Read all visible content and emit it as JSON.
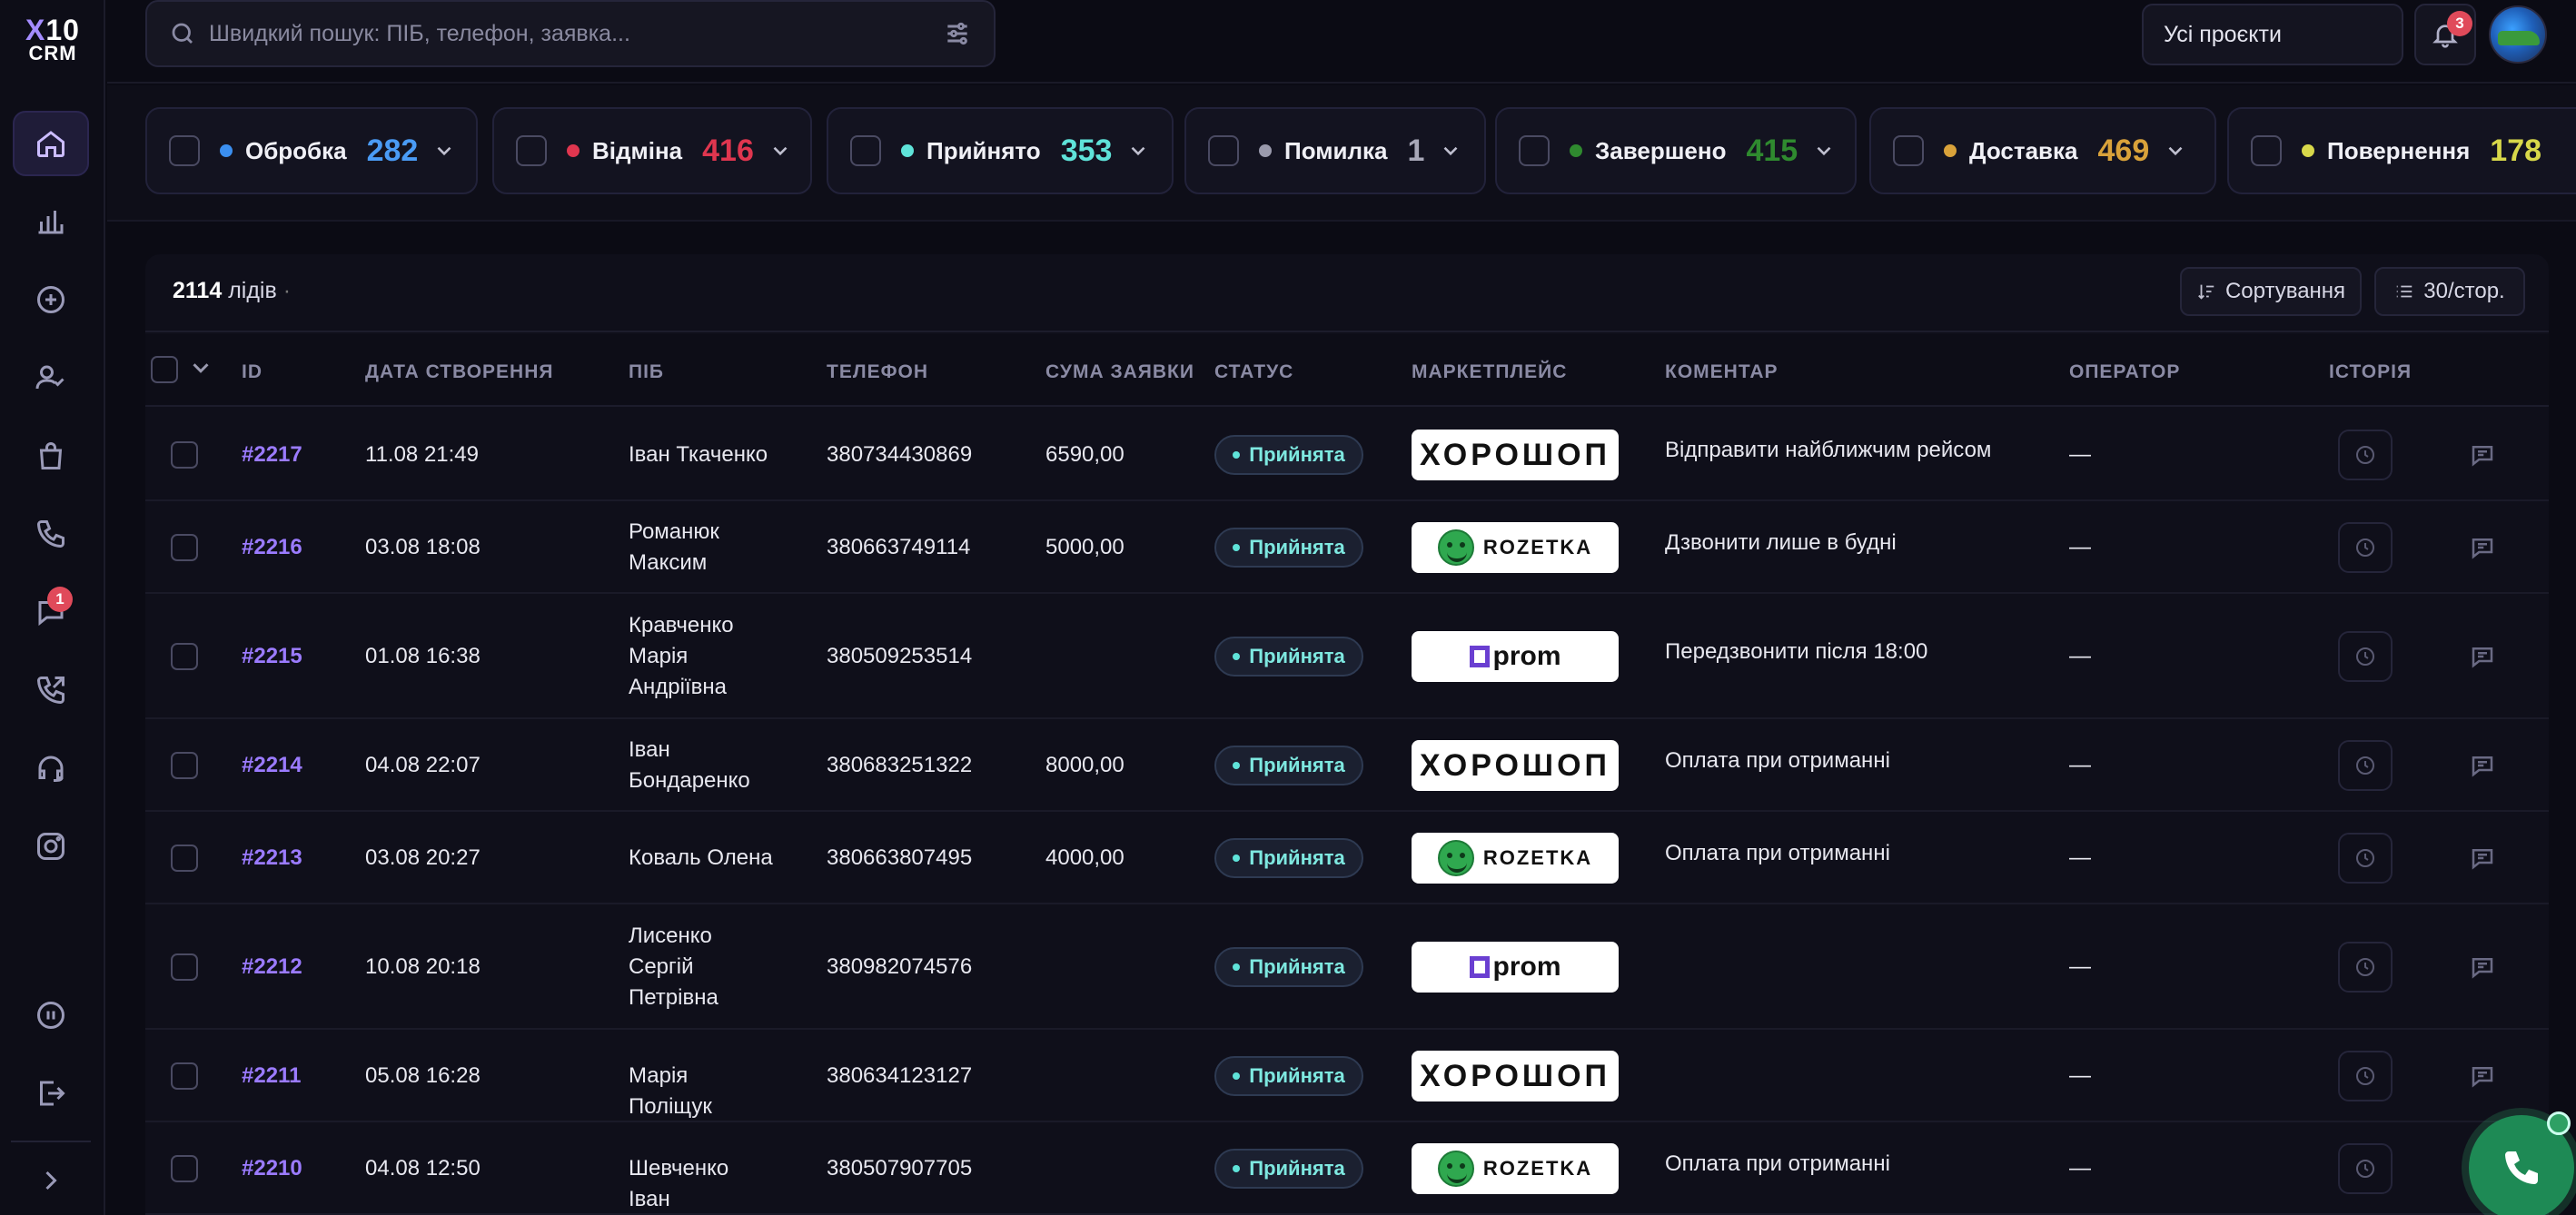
{
  "brand": {
    "logo_top": "X10",
    "logo_bottom": "CRM"
  },
  "search": {
    "placeholder": "Швидкий пошук: ПІБ, телефон, заявка..."
  },
  "header": {
    "projects_select": "Усі проєкти",
    "notifications_count": "3"
  },
  "sidebar": {
    "items": [
      {
        "icon": "home-icon",
        "active": true
      },
      {
        "icon": "bar-chart-icon"
      },
      {
        "icon": "plus-circle-icon"
      },
      {
        "icon": "user-check-icon"
      },
      {
        "icon": "shopping-bag-icon"
      },
      {
        "icon": "phone-icon"
      },
      {
        "icon": "chat-icon",
        "badge": "1"
      },
      {
        "icon": "phone-outgoing-icon"
      },
      {
        "icon": "headset-icon"
      },
      {
        "icon": "instagram-icon"
      },
      {
        "icon": "pause-icon"
      },
      {
        "icon": "logout-icon"
      },
      {
        "icon": "chevron-right-icon"
      }
    ]
  },
  "statuses": [
    {
      "name": "Обробка",
      "count": "282",
      "color": "#3b8ff0"
    },
    {
      "name": "Відміна",
      "count": "416",
      "color": "#e0364f"
    },
    {
      "name": "Прийнято",
      "count": "353",
      "color": "#5fe3d9"
    },
    {
      "name": "Помилка",
      "count": "1",
      "color": "#9a9aac"
    },
    {
      "name": "Завершено",
      "count": "415",
      "color": "#2f8a2f"
    },
    {
      "name": "Доставка",
      "count": "469",
      "color": "#d9a23a"
    },
    {
      "name": "Повернення",
      "count": "178",
      "color": "#d8d84a"
    }
  ],
  "table": {
    "total": "2114",
    "total_label": "лідів",
    "separator": "·",
    "sort_label": "Сортування",
    "per_page_label": "30/стор.",
    "columns": [
      "ID",
      "ДАТА СТВОРЕННЯ",
      "ПІБ",
      "ТЕЛЕФОН",
      "СУМА ЗАЯВКИ",
      "СТАТУС",
      "МАРКЕТПЛЕЙС",
      "КОМЕНТАР",
      "ОПЕРАТОР",
      "ІСТОРІЯ"
    ],
    "rows": [
      {
        "id": "#2217",
        "date": "11.08 21:49",
        "name": "Іван Ткаченко",
        "phone": "380734430869",
        "sum": "6590,00",
        "status": "Прийнята",
        "market": "horoshop",
        "comment": "Відправити найближчим рейсом",
        "operator": "—"
      },
      {
        "id": "#2216",
        "date": "03.08 18:08",
        "name": "Романюк Максим",
        "phone": "380663749114",
        "sum": "5000,00",
        "status": "Прийнята",
        "market": "rozetka",
        "comment": "Дзвонити лише в будні",
        "operator": "—"
      },
      {
        "id": "#2215",
        "date": "01.08 16:38",
        "name": "Кравченко Марія Андріївна",
        "phone": "380509253514",
        "sum": "",
        "status": "Прийнята",
        "market": "prom",
        "comment": "Передзвонити після 18:00",
        "operator": "—"
      },
      {
        "id": "#2214",
        "date": "04.08 22:07",
        "name": "Іван Бондаренко",
        "phone": "380683251322",
        "sum": "8000,00",
        "status": "Прийнята",
        "market": "horoshop",
        "comment": "Оплата при отриманні",
        "operator": "—"
      },
      {
        "id": "#2213",
        "date": "03.08 20:27",
        "name": "Коваль Олена",
        "phone": "380663807495",
        "sum": "4000,00",
        "status": "Прийнята",
        "market": "rozetka",
        "comment": "Оплата при отриманні",
        "operator": "—"
      },
      {
        "id": "#2212",
        "date": "10.08 20:18",
        "name": "Лисенко Сергій Петрівна",
        "phone": "380982074576",
        "sum": "",
        "status": "Прийнята",
        "market": "prom",
        "comment": "",
        "operator": "—"
      },
      {
        "id": "#2211",
        "date": "05.08 16:28",
        "name": "Марія Поліщук",
        "phone": "380634123127",
        "sum": "",
        "status": "Прийнята",
        "market": "horoshop",
        "comment": "",
        "operator": "—"
      },
      {
        "id": "#2210",
        "date": "04.08 12:50",
        "name": "Шевченко Іван",
        "phone": "380507907705",
        "sum": "",
        "status": "Прийнята",
        "market": "rozetka",
        "comment": "Оплата при отриманні",
        "operator": "—"
      }
    ]
  },
  "marketplaces": {
    "horoshop": "ХОРОШОП",
    "rozetka": "ROZETKA",
    "prom": "prom"
  }
}
